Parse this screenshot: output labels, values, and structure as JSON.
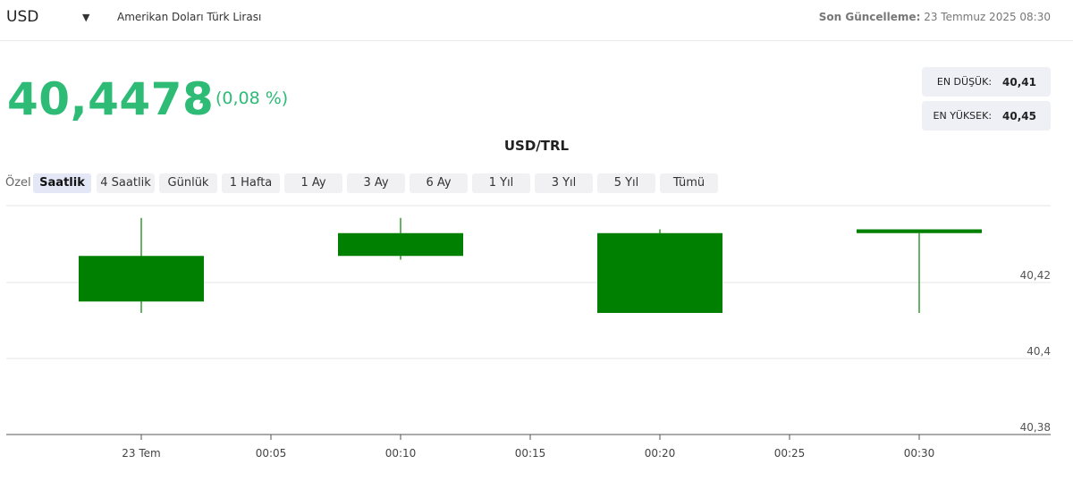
{
  "header": {
    "currency_code": "USD",
    "currency_name": "Amerikan Doları Türk Lirası",
    "last_update_label": "Son Güncelleme:",
    "last_update_value": "23 Temmuz 2025 08:30"
  },
  "quote": {
    "price": "40,4478",
    "change": "(0,08 %)",
    "direction": "up",
    "low_label": "EN DÜŞÜK:",
    "low_value": "40,41",
    "high_label": "EN YÜKSEK:",
    "high_value": "40,45"
  },
  "colors": {
    "up": "#2dbb76",
    "candle": "#008000"
  },
  "periods": {
    "label": "Özel",
    "items": [
      "Saatlik",
      "4 Saatlik",
      "Günlük",
      "1 Hafta",
      "1 Ay",
      "3 Ay",
      "6 Ay",
      "1 Yıl",
      "3 Yıl",
      "5 Yıl",
      "Tümü"
    ],
    "selected": "Saatlik"
  },
  "chart_data": {
    "type": "candlestick",
    "title": "USD/TRL",
    "x_ticks": [
      "23 Tem",
      "00:05",
      "00:10",
      "00:15",
      "00:20",
      "00:25",
      "00:30"
    ],
    "y_ticks": [
      "40,42",
      "40,4",
      "40,38"
    ],
    "ylim": [
      40.38,
      40.44
    ],
    "candles": [
      {
        "x": "00:00",
        "open": 40.415,
        "high": 40.437,
        "low": 40.412,
        "close": 40.427
      },
      {
        "x": "00:10",
        "open": 40.427,
        "high": 40.437,
        "low": 40.426,
        "close": 40.433
      },
      {
        "x": "00:20",
        "open": 40.412,
        "high": 40.434,
        "low": 40.412,
        "close": 40.433
      },
      {
        "x": "00:30",
        "open": 40.433,
        "high": 40.433,
        "low": 40.412,
        "close": 40.434
      }
    ],
    "grid": true,
    "y_axis_position": "right"
  }
}
